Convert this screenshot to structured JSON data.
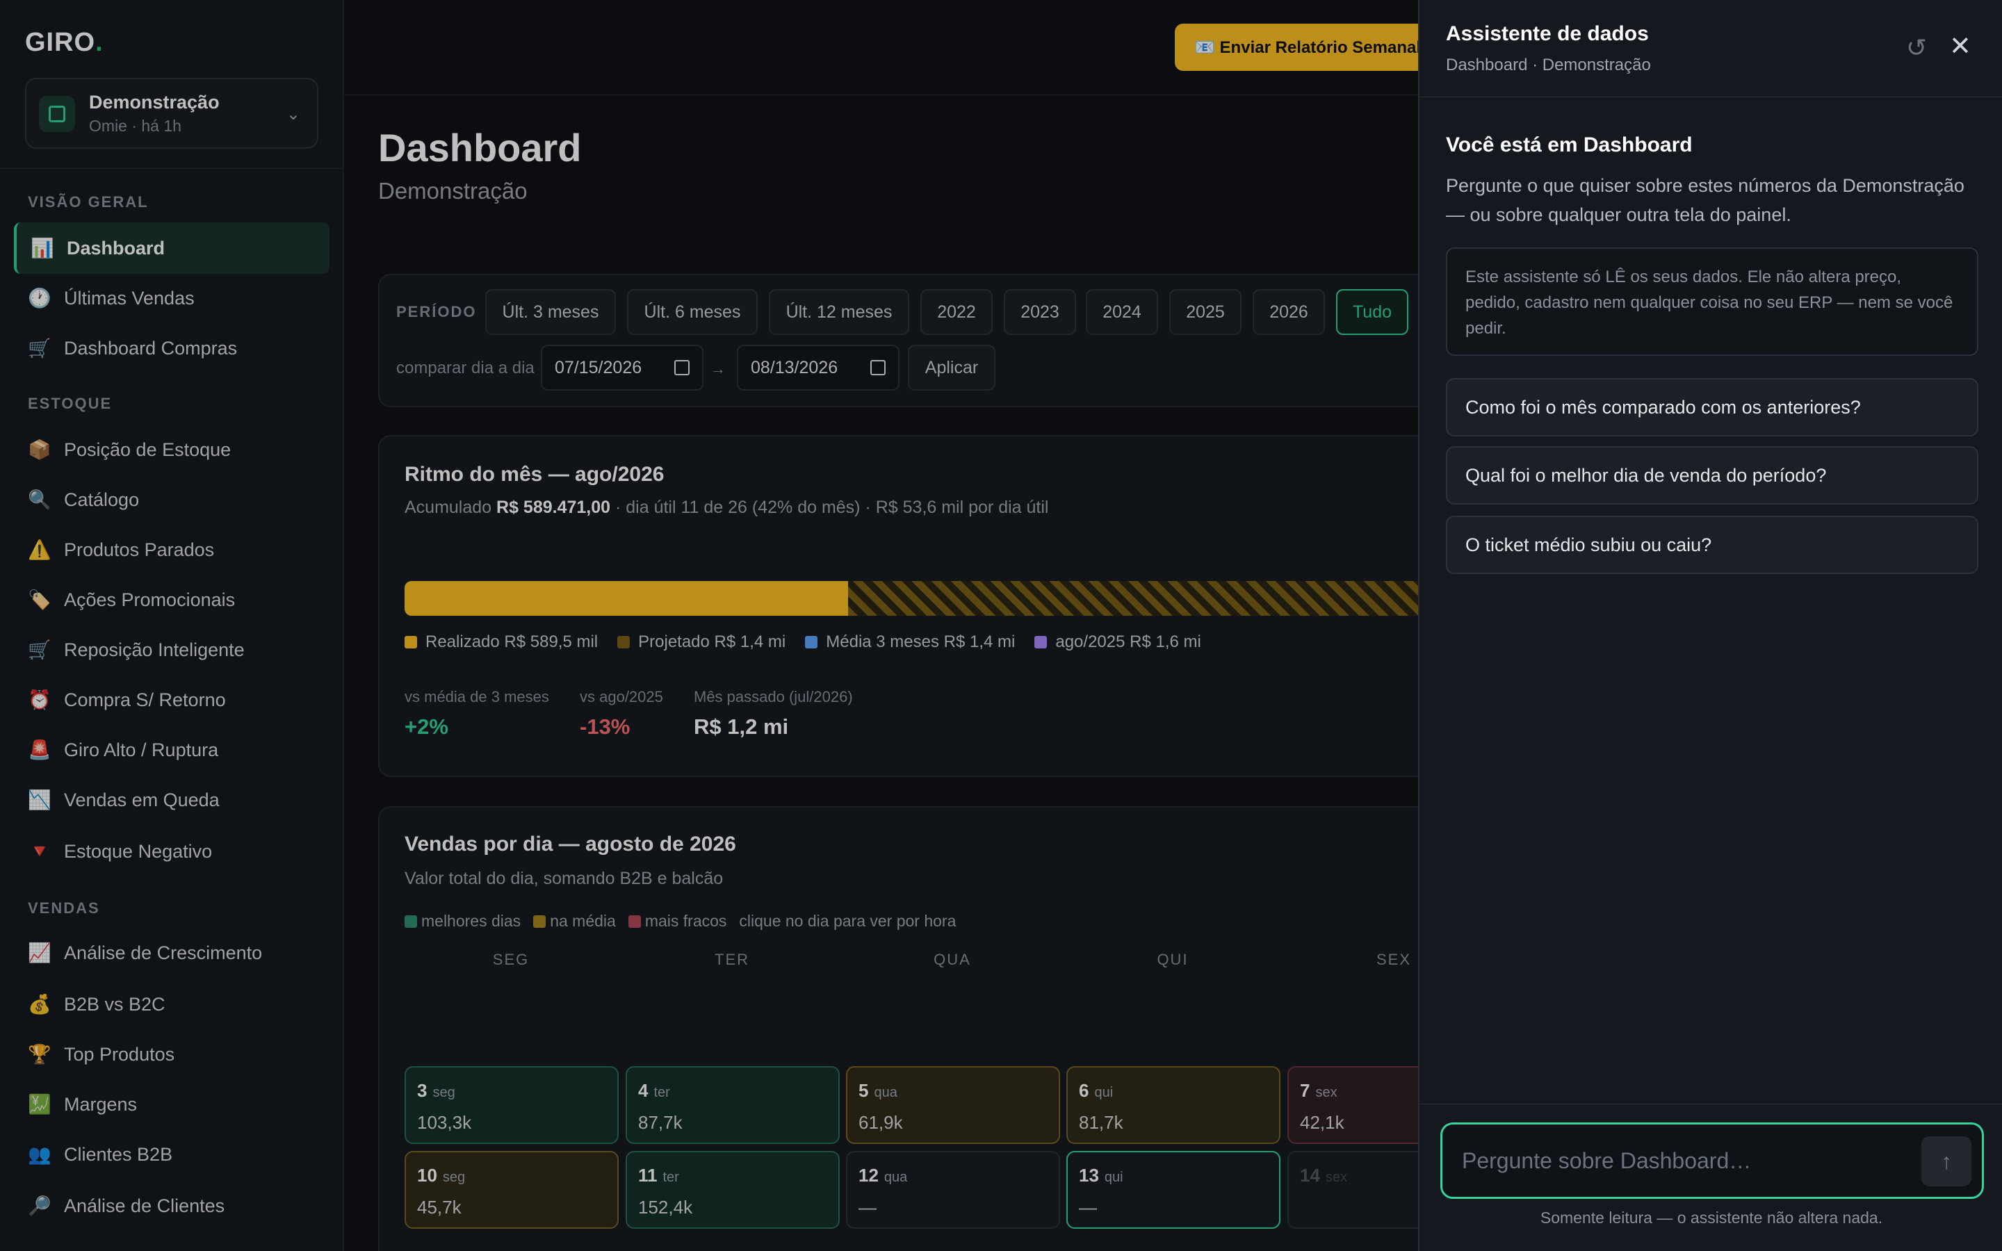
{
  "app": {
    "logo": "GIRO",
    "logo_dot": "."
  },
  "company": {
    "name": "Demonstração",
    "sub": "Omie · há 1h"
  },
  "sidebar": {
    "sections": [
      {
        "title": "VISÃO GERAL",
        "items": [
          {
            "icon": "📊",
            "label": "Dashboard"
          },
          {
            "icon": "🕐",
            "label": "Últimas Vendas"
          },
          {
            "icon": "🛒",
            "label": "Dashboard Compras"
          }
        ]
      },
      {
        "title": "ESTOQUE",
        "items": [
          {
            "icon": "📦",
            "label": "Posição de Estoque"
          },
          {
            "icon": "🔍",
            "label": "Catálogo"
          },
          {
            "icon": "⚠️",
            "label": "Produtos Parados"
          },
          {
            "icon": "🏷️",
            "label": "Ações Promocionais"
          },
          {
            "icon": "🛒",
            "label": "Reposição Inteligente"
          },
          {
            "icon": "⏰",
            "label": "Compra S/ Retorno"
          },
          {
            "icon": "🚨",
            "label": "Giro Alto / Ruptura"
          },
          {
            "icon": "📉",
            "label": "Vendas em Queda"
          },
          {
            "icon": "🔻",
            "label": "Estoque Negativo"
          }
        ]
      },
      {
        "title": "VENDAS",
        "items": [
          {
            "icon": "📈",
            "label": "Análise de Crescimento"
          },
          {
            "icon": "💰",
            "label": "B2B vs B2C"
          },
          {
            "icon": "🏆",
            "label": "Top Produtos"
          },
          {
            "icon": "💹",
            "label": "Margens"
          },
          {
            "icon": "👥",
            "label": "Clientes B2B"
          },
          {
            "icon": "🔎",
            "label": "Análise de Clientes"
          }
        ]
      }
    ]
  },
  "topbar": {
    "report_button": "📧 Enviar Relatório Semanal"
  },
  "page": {
    "title": "Dashboard",
    "subtitle": "Demonstração"
  },
  "period": {
    "label": "PERÍODO",
    "options": [
      "Últ. 3 meses",
      "Últ. 6 meses",
      "Últ. 12 meses",
      "2022",
      "2023",
      "2024",
      "2025",
      "2026",
      "Tudo"
    ],
    "selected": "Tudo",
    "compare_label": "comparar dia a dia",
    "date_from": "07/15/2026",
    "date_to": "08/13/2026",
    "arrow": "→",
    "apply": "Aplicar"
  },
  "rhythm": {
    "title": "Ritmo do mês — ago/2026",
    "sub_prefix": "Acumulado",
    "sub_amount": "R$ 589.471,00",
    "sub_rest": " · dia útil 11 de 26 (42% do mês) · R$ 53,6 mil por dia útil",
    "realized_fraction": 0.42,
    "legend": [
      {
        "label": "Realizado R$ 589,5 mil",
        "color": "#fbbf24"
      },
      {
        "label": "Projetado R$ 1,4 mi",
        "color": "#7a5f16"
      },
      {
        "label": "Média 3 meses R$ 1,4 mi",
        "color": "#60a5fa"
      },
      {
        "label": "ago/2025 R$ 1,6 mi",
        "color": "#a78bfa"
      }
    ],
    "kpis": [
      {
        "label": "vs média de 3 meses",
        "value": "+2%",
        "color": "#34d399"
      },
      {
        "label": "vs ago/2025",
        "value": "-13%",
        "color": "#f87171"
      },
      {
        "label": "Mês passado (jul/2026)",
        "value": "R$ 1,2 mi",
        "color": "#ffffff"
      }
    ]
  },
  "daily": {
    "title": "Vendas por dia — agosto de 2026",
    "subtitle": "Valor total do dia, somando B2B e balcão",
    "legend": [
      {
        "label": "melhores dias",
        "color": "#2f8f6f"
      },
      {
        "label": "na média",
        "color": "#a8861e"
      },
      {
        "label": "mais fracos",
        "color": "#b04a5a"
      }
    ],
    "hint": "clique no dia para ver por hora",
    "weekdays": [
      "SEG",
      "TER",
      "QUA",
      "QUI",
      "SEX"
    ],
    "weeks": [
      [
        {
          "day": "3",
          "wd": "seg",
          "value": "103,3k",
          "status": "good"
        },
        {
          "day": "4",
          "wd": "ter",
          "value": "87,7k",
          "status": "good"
        },
        {
          "day": "5",
          "wd": "qua",
          "value": "61,9k",
          "status": "avg"
        },
        {
          "day": "6",
          "wd": "qui",
          "value": "81,7k",
          "status": "avg"
        },
        {
          "day": "7",
          "wd": "sex",
          "value": "42,1k",
          "status": "low"
        }
      ],
      [
        {
          "day": "10",
          "wd": "seg",
          "value": "45,7k",
          "status": "avg"
        },
        {
          "day": "11",
          "wd": "ter",
          "value": "152,4k",
          "status": "good"
        },
        {
          "day": "12",
          "wd": "qua",
          "value": "—",
          "status": "none"
        },
        {
          "day": "13",
          "wd": "qui",
          "value": "—",
          "status": "today"
        },
        {
          "day": "14",
          "wd": "sex",
          "value": "",
          "status": "future"
        }
      ]
    ]
  },
  "assistant": {
    "title": "Assistente de dados",
    "subtitle": "Dashboard · Demonstração",
    "context_title": "Você está em Dashboard",
    "context_text": "Pergunte o que quiser sobre estes números da Demonstração — ou sobre qualquer outra tela do painel.",
    "notice": "Este assistente só LÊ os seus dados. Ele não altera preço, pedido, cadastro nem qualquer coisa no seu ERP — nem se você pedir.",
    "suggestions": [
      "Como foi o mês comparado com os anteriores?",
      "Qual foi o melhor dia de venda do período?",
      "O ticket médio subiu ou caiu?"
    ],
    "input_placeholder": "Pergunte sobre Dashboard…",
    "footer_note": "Somente leitura — o assistente não altera nada."
  }
}
